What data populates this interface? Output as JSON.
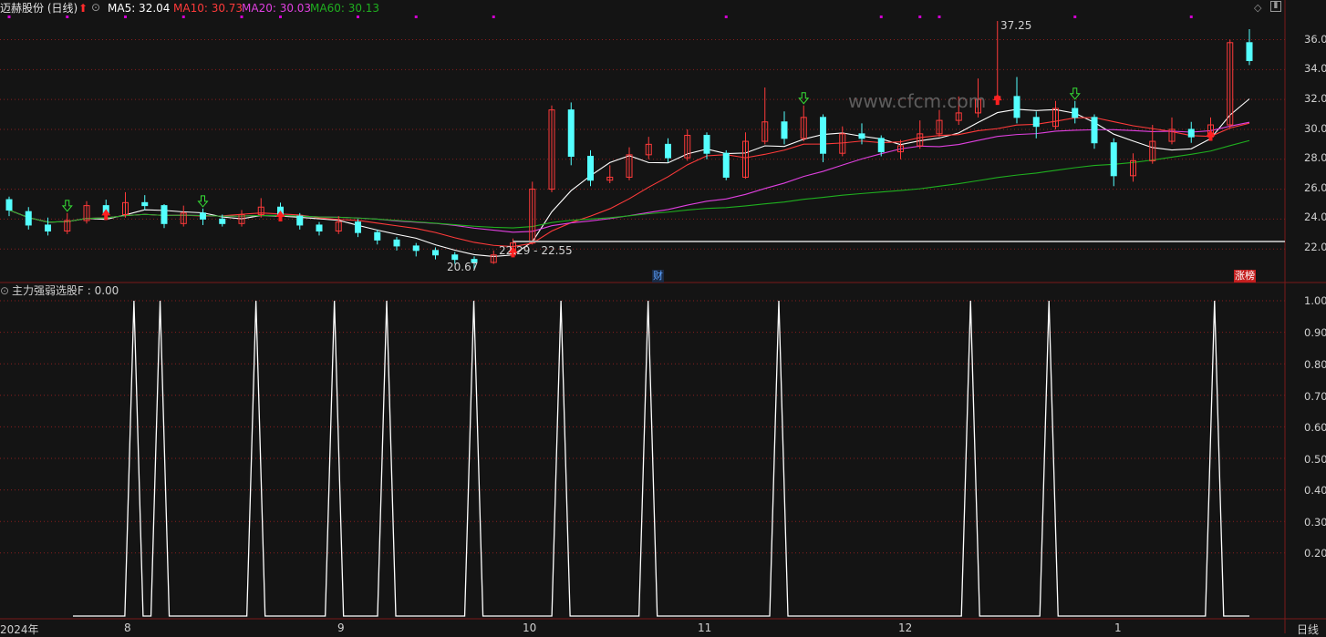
{
  "header": {
    "stock_name": "迈赫股份 (日线)",
    "ma5_label": "MA5: 32.04",
    "ma10_label": "MA10: 30.73",
    "ma20_label": "MA20: 30.03",
    "ma60_label": "MA60: 30.13"
  },
  "colors": {
    "background": "#141414",
    "up": "#ff3a3a",
    "down": "#54ffff",
    "ma5": "#ffffff",
    "ma10": "#ff3a3a",
    "ma20": "#e040e0",
    "ma60": "#1faf1f",
    "grid": "#8a1e1e",
    "signal_dot": "#d000d0",
    "support_line": "#a8a8a8"
  },
  "annotations": {
    "high_label": "37.25",
    "low_label": "20.67",
    "range_label": "22.29 - 22.55",
    "finance_badge": "财",
    "limit_badge": "涨榜",
    "watermark": "www.cfcm.com"
  },
  "indicator": {
    "title": "主力强弱选股F : 0.00"
  },
  "footer": {
    "period": "日线"
  },
  "chart_data": [
    {
      "type": "candlestick",
      "title": "迈赫股份 (日线)",
      "ylim": [
        20.0,
        37.8
      ],
      "yticks": [
        "36.00",
        "34.00",
        "32.00",
        "30.00",
        "28.00",
        "26.00",
        "24.00",
        "22.00"
      ],
      "ytick_values": [
        36,
        34,
        32,
        30,
        28,
        26,
        24,
        22
      ],
      "xticks": [
        "2024年",
        "8",
        "9",
        "10",
        "11",
        "12",
        "1"
      ],
      "xtick_index": [
        2,
        7,
        19,
        30,
        40,
        51,
        62
      ],
      "support_level": 22.5,
      "series": [
        {
          "name": "MA5",
          "values": []
        },
        {
          "name": "MA10",
          "values": []
        },
        {
          "name": "MA20",
          "values": []
        },
        {
          "name": "MA60",
          "values": []
        }
      ],
      "candles": [
        [
          25.3,
          24.6,
          25.5,
          24.2
        ],
        [
          24.5,
          23.6,
          24.8,
          23.3
        ],
        [
          23.6,
          23.2,
          24.1,
          22.9
        ],
        [
          23.2,
          23.9,
          24.4,
          23.0
        ],
        [
          23.9,
          24.9,
          25.2,
          23.7
        ],
        [
          24.9,
          24.3,
          25.3,
          24.0
        ],
        [
          24.3,
          25.1,
          25.8,
          24.1
        ],
        [
          25.1,
          24.9,
          25.6,
          24.6
        ],
        [
          24.9,
          23.7,
          25.0,
          23.4
        ],
        [
          23.7,
          24.4,
          24.9,
          23.5
        ],
        [
          24.4,
          24.0,
          24.7,
          23.6
        ],
        [
          24.0,
          23.7,
          24.3,
          23.5
        ],
        [
          23.7,
          24.3,
          24.6,
          23.5
        ],
        [
          24.3,
          24.8,
          25.4,
          24.1
        ],
        [
          24.8,
          24.2,
          25.1,
          23.9
        ],
        [
          24.2,
          23.6,
          24.4,
          23.3
        ],
        [
          23.6,
          23.2,
          23.8,
          22.9
        ],
        [
          23.2,
          23.8,
          24.2,
          23.0
        ],
        [
          23.8,
          23.1,
          24.0,
          22.8
        ],
        [
          23.1,
          22.6,
          23.3,
          22.3
        ],
        [
          22.6,
          22.2,
          22.8,
          21.9
        ],
        [
          22.2,
          21.9,
          22.4,
          21.5
        ],
        [
          21.9,
          21.6,
          22.1,
          21.3
        ],
        [
          21.6,
          21.3,
          21.8,
          21.0
        ],
        [
          21.3,
          21.1,
          21.5,
          20.67
        ],
        [
          21.1,
          21.6,
          21.9,
          21.0
        ],
        [
          21.6,
          22.4,
          22.7,
          21.5
        ],
        [
          22.4,
          26.0,
          26.5,
          22.3
        ],
        [
          26.0,
          31.3,
          31.6,
          25.8
        ],
        [
          31.3,
          28.2,
          31.8,
          27.6
        ],
        [
          28.2,
          26.6,
          28.6,
          26.2
        ],
        [
          26.6,
          26.8,
          27.6,
          26.4
        ],
        [
          26.8,
          28.3,
          28.8,
          26.6
        ],
        [
          28.3,
          29.0,
          29.5,
          28.0
        ],
        [
          29.0,
          28.1,
          29.4,
          27.8
        ],
        [
          28.1,
          29.6,
          30.0,
          27.9
        ],
        [
          29.6,
          28.4,
          29.8,
          28.0
        ],
        [
          28.4,
          26.8,
          28.6,
          26.6
        ],
        [
          26.8,
          29.2,
          29.8,
          26.7
        ],
        [
          29.2,
          30.5,
          32.8,
          29.0
        ],
        [
          30.5,
          29.4,
          31.2,
          29.0
        ],
        [
          29.4,
          30.8,
          31.6,
          29.2
        ],
        [
          30.8,
          28.4,
          31.0,
          27.8
        ],
        [
          28.4,
          29.7,
          30.2,
          28.2
        ],
        [
          29.7,
          29.4,
          30.4,
          29.0
        ],
        [
          29.4,
          28.5,
          29.6,
          28.2
        ],
        [
          28.5,
          28.9,
          29.3,
          28.0
        ],
        [
          28.9,
          29.7,
          30.6,
          28.7
        ],
        [
          29.7,
          30.6,
          31.3,
          29.5
        ],
        [
          30.6,
          31.1,
          32.2,
          30.3
        ],
        [
          31.1,
          32.0,
          33.4,
          30.8
        ],
        [
          32.0,
          32.2,
          37.25,
          31.7
        ],
        [
          32.2,
          30.8,
          33.5,
          30.4
        ],
        [
          30.8,
          30.2,
          31.2,
          29.4
        ],
        [
          30.2,
          31.4,
          31.9,
          30.0
        ],
        [
          31.4,
          30.8,
          31.9,
          30.4
        ],
        [
          30.8,
          29.1,
          31.0,
          28.7
        ],
        [
          29.1,
          26.9,
          29.4,
          26.2
        ],
        [
          26.9,
          27.9,
          28.4,
          26.5
        ],
        [
          27.9,
          29.2,
          30.3,
          27.7
        ],
        [
          29.2,
          30.0,
          30.8,
          29.0
        ],
        [
          30.0,
          29.5,
          30.5,
          29.1
        ],
        [
          29.5,
          30.3,
          30.8,
          29.3
        ],
        [
          30.3,
          35.8,
          36.0,
          30.1
        ],
        [
          35.8,
          34.6,
          36.7,
          34.3
        ]
      ]
    },
    {
      "type": "line",
      "title": "主力强弱选股F",
      "ylim": [
        0.0,
        1.0
      ],
      "yticks": [
        "1.00",
        "0.90",
        "0.80",
        "0.70",
        "0.60",
        "0.50",
        "0.40",
        "0.30",
        "0.20"
      ],
      "ytick_values": [
        1.0,
        0.9,
        0.8,
        0.7,
        0.6,
        0.5,
        0.4,
        0.3,
        0.2
      ],
      "signal_bars": [
        7,
        10,
        21,
        30,
        36,
        46,
        56,
        66,
        81,
        103,
        112,
        131
      ]
    }
  ]
}
